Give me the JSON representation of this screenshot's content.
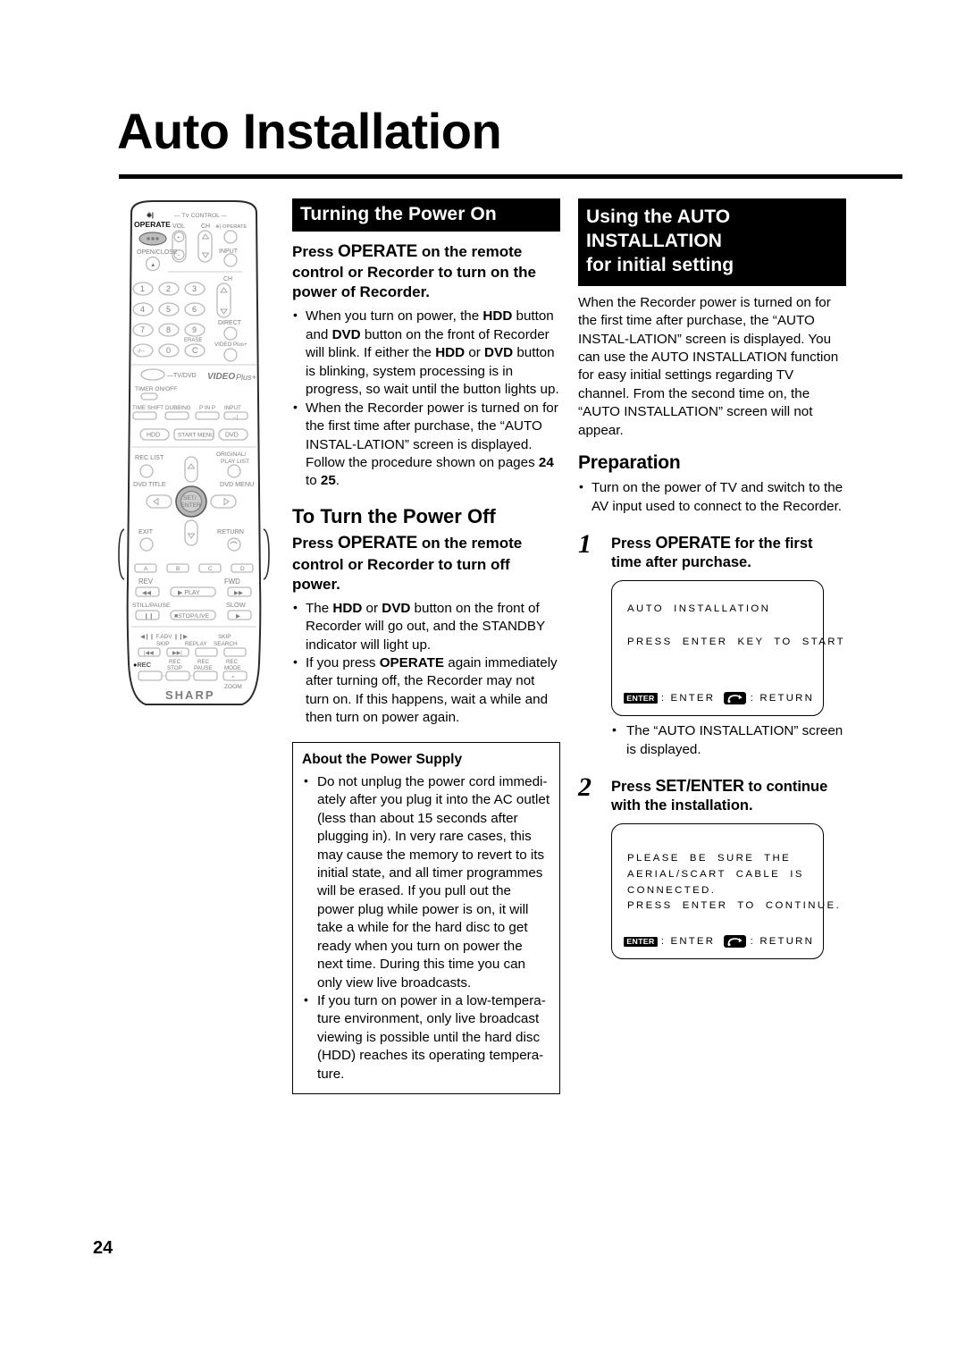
{
  "page": {
    "title": "Auto Installation",
    "number": "24"
  },
  "remote": {
    "brand": "SHARP",
    "logo_text": "VIDEO Plus+",
    "labels": {
      "operate": "OPERATE",
      "tv_control": "— TV CONTROL —",
      "vol": "VOL",
      "ch": "CH",
      "tv_operate": "OPERATE",
      "open_close": "OPEN/CLOSE",
      "input": "INPUT",
      "ch_right": "CH",
      "direct": "DIRECT",
      "erase": "ERASE",
      "video_plus": "VIDEO Plus+",
      "tv_dvd": "TV/DVD",
      "timer_on_off": "TIMER ON/OFF",
      "time_shift": "TIME SHIFT",
      "dubbing": "DUBBING",
      "p_in_p": "P IN P",
      "input2": "INPUT",
      "hdd": "HDD",
      "start_menu": "START MENU",
      "dvd": "DVD",
      "rec_list": "REC LIST",
      "original_play_list": "ORIGINAL/ PLAY LIST",
      "dvd_title": "DVD TITLE",
      "dvd_menu": "DVD MENU",
      "set_enter": "SET/ ENTER",
      "exit": "EXIT",
      "return": "RETURN",
      "abcd": [
        "A",
        "B",
        "C",
        "D"
      ],
      "rev": "REV",
      "fwd": "FWD",
      "play": "PLAY",
      "still_pause": "STILL/PAUSE",
      "slow": "SLOW",
      "stop_live": "STOP/LIVE",
      "f_adv": "F.ADV",
      "skip": "SKIP",
      "replay": "REPLAY",
      "skip_search": "SKIP SEARCH",
      "rec": "REC",
      "rec_stop": "REC STOP",
      "rec_pause": "REC PAUSE",
      "rec_mode": "REC MODE",
      "zoom": "ZOOM",
      "numbers": [
        "1",
        "2",
        "3",
        "4",
        "5",
        "6",
        "7",
        "8",
        "9",
        "-/--",
        "0",
        "C"
      ]
    }
  },
  "middle_column": {
    "header": "Turning the Power On",
    "intro_bold_pre": "Press ",
    "intro_bold_strong": "OPERATE",
    "intro_bold_post": " on the remote control or Recorder to turn on the power of Recorder.",
    "bullets": [
      "When you turn on power, the HDD button and DVD button on the front of Recorder will blink. If either the HDD or DVD button is blinking, system processing is in progress, so wait until the button lights up.",
      "When the Recorder power is turned on for the first time after purchase, the “AUTO INSTAL-LATION” screen is displayed. Follow the procedure shown on pages 24 to 25."
    ],
    "power_off_heading": "To Turn the Power Off",
    "power_off_bold_pre": "Press ",
    "power_off_bold_strong": "OPERATE",
    "power_off_bold_post": " on the remote control or Recorder to turn off power.",
    "power_off_bullets": [
      "The HDD or DVD button on the front of Recorder will go out, and the STANDBY indicator will light up.",
      "If you press OPERATE again immediately after turning off, the Recorder may not turn on. If this happens, wait a while and then turn on power again."
    ],
    "power_supply_box": {
      "title": "About the Power Supply",
      "bullets": [
        "Do not unplug the power cord immedi-ately after you plug it into the AC outlet (less than about 15 seconds after plugging in). In very rare cases, this may cause the memory to revert to its initial state, and all timer programmes will be erased. If you pull out the power plug while power is on, it will take a while for the hard disc to get ready when you turn on power the next time. During this time you can only view live broadcasts.",
        "If you turn on power in a low-tempera-ture environment, only live broadcast viewing is possible until the hard disc (HDD) reaches its operating tempera-ture."
      ]
    }
  },
  "right_column": {
    "header_lines": [
      "Using the AUTO",
      "INSTALLATION",
      "for initial setting"
    ],
    "intro": "When the Recorder power is turned on for the first time after purchase, the “AUTO INSTAL-LATION” screen is displayed. You can use the AUTO INSTALLATION function for easy initial settings regarding TV channel. From the second time on, the “AUTO INSTALLATION” screen will not appear.",
    "preparation_heading": "Preparation",
    "preparation_bullets": [
      "Turn on the power of TV and switch to the AV input used to connect to the Recorder."
    ],
    "steps": [
      {
        "number": "1",
        "text_pre": "Press ",
        "text_strong": "OPERATE",
        "text_post": " for the first time after purchase.",
        "osd_lines": [
          "AUTO  INSTALLATION",
          "",
          "PRESS  ENTER  KEY  TO  START"
        ],
        "osd_enter_label": ": ENTER",
        "osd_return_label": ": RETURN",
        "after_bullets": [
          "The “AUTO INSTALLATION” screen is displayed."
        ]
      },
      {
        "number": "2",
        "text_pre": "Press ",
        "text_strong": "SET/ENTER",
        "text_post": " to continue with the installation.",
        "osd_lines": [
          "PLEASE  BE  SURE  THE",
          "AERIAL/SCART  CABLE  IS",
          "CONNECTED.",
          "PRESS  ENTER  TO  CONTINUE."
        ],
        "osd_enter_label": ": ENTER",
        "osd_return_label": ": RETURN",
        "after_bullets": []
      }
    ],
    "enter_badge_text": "ENTER"
  }
}
